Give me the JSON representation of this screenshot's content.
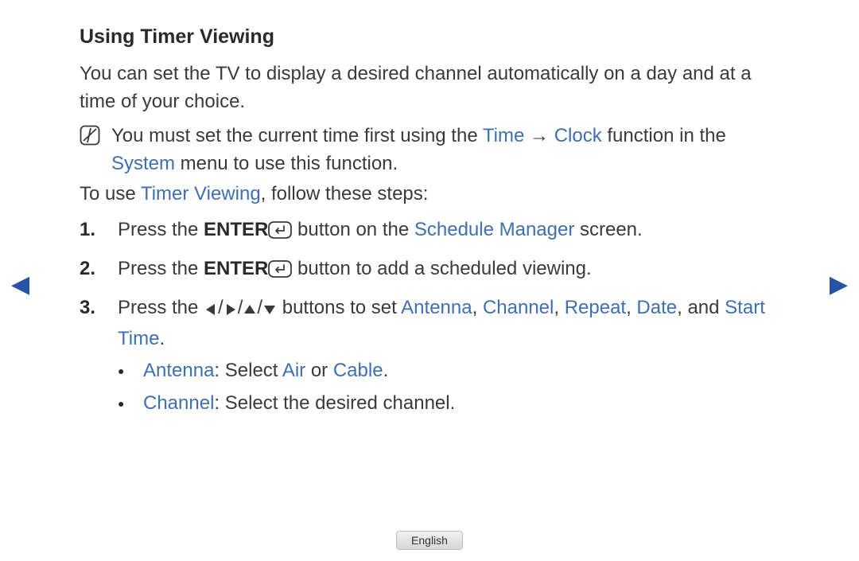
{
  "title": "Using Timer Viewing",
  "intro": "You can set the TV to display a desired channel automatically on a day and at a time of your choice.",
  "note": {
    "pre": "You must set the current time first using the ",
    "time": "Time",
    "arrow": " → ",
    "clock": "Clock",
    "mid": " function in the ",
    "system": "System",
    "post": " menu to use this function."
  },
  "to_use": {
    "pre": "To use ",
    "timer_viewing": "Timer Viewing",
    "post": ", follow these steps:"
  },
  "steps": [
    {
      "pre": "Press the ",
      "enter": "ENTER",
      "mid": " button on the ",
      "schedule_manager": "Schedule Manager",
      "post": " screen."
    },
    {
      "pre": "Press the ",
      "enter": "ENTER",
      "post": " button to add a scheduled viewing."
    },
    {
      "pre": "Press the ",
      "slash": "/",
      "mid": " buttons to set ",
      "antenna": "Antenna",
      "c": ", ",
      "channel": "Channel",
      "repeat": "Repeat",
      "date": "Date",
      "and": ", and ",
      "start_time": "Start Time",
      "dot": ".",
      "bullets": [
        {
          "label": "Antenna",
          "colon": ": Select ",
          "opt1": "Air",
          "or": " or ",
          "opt2": "Cable",
          "dot": "."
        },
        {
          "label": "Channel",
          "rest": ": Select the desired channel."
        }
      ]
    }
  ],
  "lang": "English"
}
